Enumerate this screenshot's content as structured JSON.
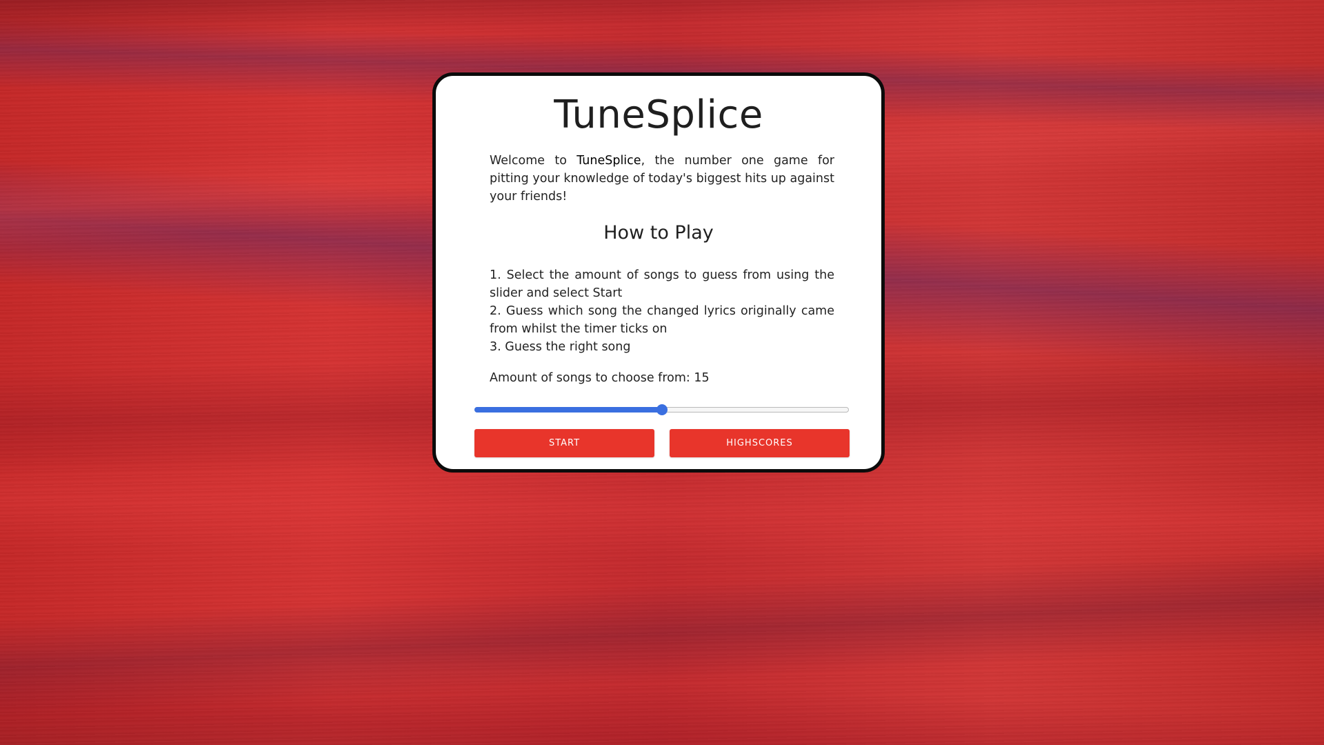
{
  "app": {
    "title": "TuneSplice"
  },
  "intro": {
    "prefix": "Welcome to ",
    "brand": "TuneSplice",
    "suffix": ", the number one game for pitting your knowledge of today's biggest hits up against your friends!"
  },
  "how_to_play": {
    "heading": "How to Play",
    "steps": [
      {
        "text": "1. Select the amount of songs to guess from using the slider and select ",
        "emphasis": "Start"
      },
      {
        "text": "2. Guess which song the changed lyrics originally came from whilst the timer ticks on",
        "emphasis": ""
      },
      {
        "text": "3. Guess the right song",
        "emphasis": ""
      }
    ]
  },
  "amount": {
    "label": "Amount of songs to choose from: ",
    "value": "15"
  },
  "slider": {
    "fraction": 0.5,
    "accent_color": "#3a6fe0"
  },
  "buttons": {
    "start_label": "START",
    "highscores_label": "HIGHSCORES",
    "color": "#e8352b"
  },
  "background": {
    "description_colors": [
      "#c62828",
      "#5f285a"
    ]
  }
}
